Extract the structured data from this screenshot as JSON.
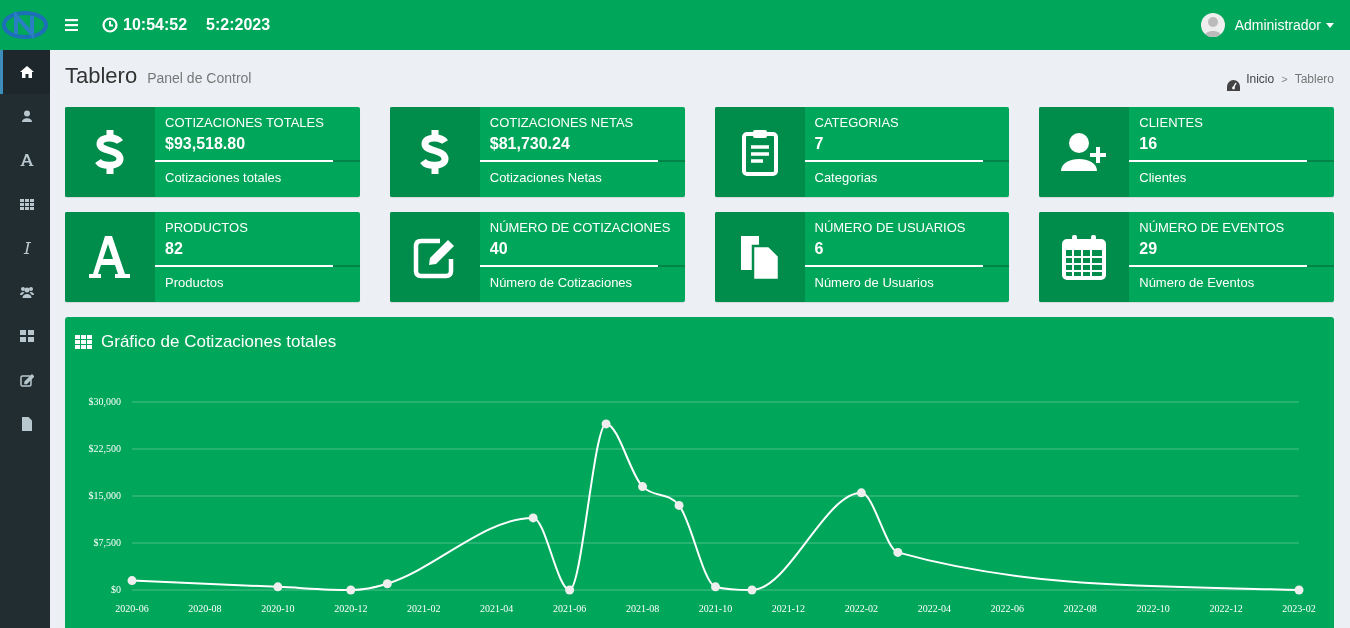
{
  "topbar": {
    "time": "10:54:52",
    "date": "5:2:2023",
    "user": "Administrador"
  },
  "sidebar": {
    "items": [
      {
        "selected": true
      },
      {
        "selected": false
      },
      {
        "selected": false
      },
      {
        "selected": false
      },
      {
        "selected": false
      },
      {
        "selected": false
      },
      {
        "selected": false
      },
      {
        "selected": false
      },
      {
        "selected": false
      }
    ]
  },
  "header": {
    "title": "Tablero",
    "subtitle": "Panel de Control"
  },
  "breadcrumb": {
    "items": [
      "Inicio",
      "Tablero"
    ],
    "separator": ">"
  },
  "stats": [
    {
      "title": "COTIZACIONES TOTALES",
      "value": "$93,518.80",
      "level": 0.87,
      "description": "Cotizaciones totales"
    },
    {
      "title": "COTIZACIONES NETAS",
      "value": "$81,730.24",
      "level": 0.87,
      "description": "Cotizaciones Netas"
    },
    {
      "title": "CATEGORIAS",
      "value": "7",
      "level": 0.87,
      "description": "Categorias"
    },
    {
      "title": "CLIENTES",
      "value": "16",
      "level": 0.87,
      "description": "Clientes"
    },
    {
      "title": "PRODUCTOS",
      "value": "82",
      "level": 0.87,
      "description": "Productos"
    },
    {
      "title": "NÚMERO DE COTIZACIONES",
      "value": "40",
      "level": 0.87,
      "description": "Número de Cotizaciones"
    },
    {
      "title": "NÚMERO DE USUARIOS",
      "value": "6",
      "level": 0.87,
      "description": "Número de Usuarios"
    },
    {
      "title": "NÚMERO DE EVENTOS",
      "value": "29",
      "level": 0.87,
      "description": "Número de Eventos"
    }
  ],
  "chart_panel": {
    "title": "Gráfico de Cotizaciones totales",
    "chart_data": {
      "type": "line",
      "categories": [
        "2020-06",
        null,
        "2020-08",
        null,
        "2020-10",
        null,
        "2020-12",
        null,
        "2021-02",
        null,
        "2021-04",
        null,
        "2021-06",
        null,
        "2021-08",
        null,
        "2021-10",
        null,
        "2021-12",
        null,
        "2022-02",
        null,
        "2022-04",
        null,
        "2022-06",
        null,
        "2022-08",
        null,
        "2022-10",
        null,
        "2022-12",
        null,
        "2023-02"
      ],
      "grid": true,
      "series": [
        {
          "color": "#ffffff",
          "marker": true,
          "values": [
            1500,
            null,
            null,
            null,
            500,
            null,
            0,
            1000,
            null,
            null,
            null,
            11500,
            0,
            26500,
            16500,
            13500,
            500,
            0,
            null,
            null,
            15500,
            6000,
            null,
            null,
            null,
            null,
            null,
            null,
            null,
            null,
            null,
            null,
            0
          ]
        }
      ],
      "ylim": [
        0,
        30000
      ],
      "yticks": [
        {
          "value": 0,
          "label": "$0"
        },
        {
          "value": 7500,
          "label": "$7,500"
        },
        {
          "value": 15000,
          "label": "$15,000"
        },
        {
          "value": 22500,
          "label": "$22,500"
        },
        {
          "value": 30000,
          "label": "$30,000"
        }
      ]
    }
  }
}
